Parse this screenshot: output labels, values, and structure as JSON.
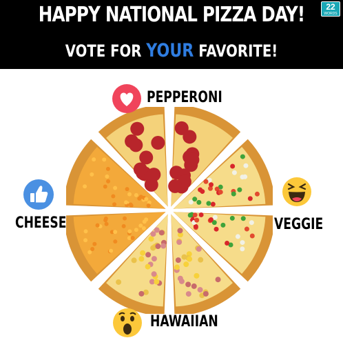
{
  "header": {
    "title": "HAPPY NATIONAL PIZZA DAY!",
    "subtitle_before": "VOTE FOR",
    "subtitle_highlight": "YOUR",
    "subtitle_after": "FAVORITE!",
    "highlight_color": "#2f7de1",
    "logo_text": "22",
    "logo_subtext": "WORDS"
  },
  "options": [
    {
      "label": "PEPPERONI",
      "icon": "heart-reaction-icon",
      "color": "#f0445b"
    },
    {
      "label": "VEGGIE",
      "icon": "haha-reaction-icon",
      "color": "#fcc83a"
    },
    {
      "label": "HAWAIIAN",
      "icon": "wow-reaction-icon",
      "color": "#fcc83a"
    },
    {
      "label": "CHEESE",
      "icon": "like-reaction-icon",
      "color": "#4a90e2"
    }
  ]
}
